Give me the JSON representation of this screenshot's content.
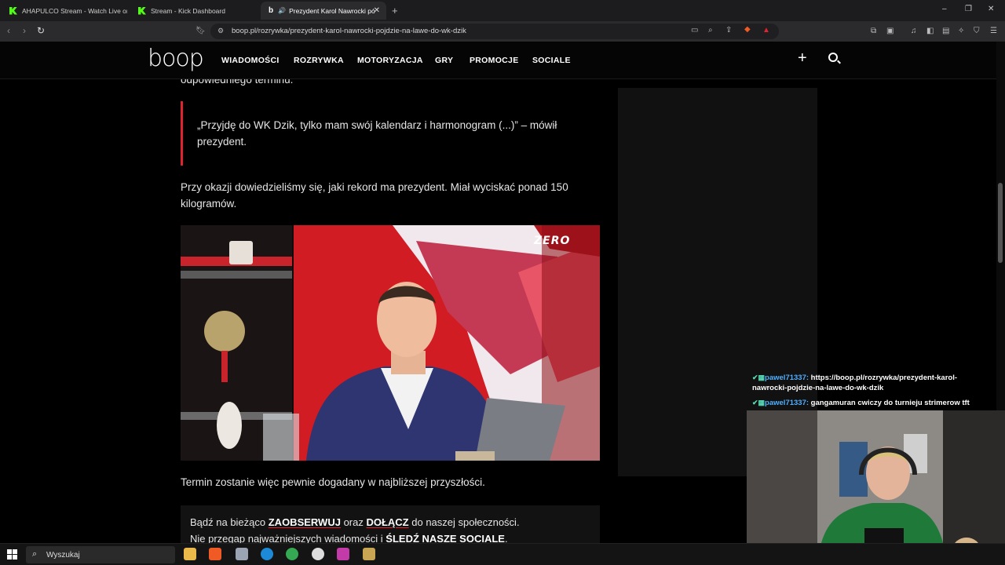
{
  "browser": {
    "tabs": [
      {
        "label": "AHAPULCO Stream - Watch Live on K",
        "active": false
      },
      {
        "label": "Stream - Kick Dashboard",
        "active": false
      },
      {
        "label": "Prezydent Karol Nawrocki pó",
        "active": true
      }
    ],
    "new_tab_label": "+",
    "url": "boop.pl/rozrywka/prezydent-karol-nawrocki-pojdzie-na-lawe-do-wk-dzik",
    "window_controls": [
      "–",
      "❐",
      "✕"
    ]
  },
  "site": {
    "logo": "boop",
    "nav": [
      "WIADOMOŚCI",
      "ROZRYWKA",
      "MOTORYZACJA",
      "GRY",
      "PROMOCJE",
      "SOCIALE"
    ],
    "accent": "#e0242e"
  },
  "article": {
    "fragment_top": "odpowiedniego terminu.",
    "quote": "„Przyjdę do WK Dzik, tylko mam swój kalendarz i harmonogram (...)” – mówił prezydent.",
    "paragraph1": "Przy okazji dowiedzieliśmy się, jaki rekord ma prezydent. Miał wyciskać ponad 150 kilogramów.",
    "image_watermark": "ZERO",
    "paragraph2": "Termin zostanie więc pewnie dogadany w najbliższej przyszłości.",
    "cta": {
      "line1_prefix": "Bądź na bieżąco ",
      "line1_link1": "ZAOBSERWUJ",
      "line1_mid": " oraz ",
      "line1_link2": "DOŁĄCZ",
      "line1_suffix": " do naszej społeczności.",
      "line2_prefix": "Nie przegap najważniejszych wiadomości i ",
      "line2_link": "ŚLEDŹ NASZE SOCIALE",
      "line2_suffix": "."
    }
  },
  "chat": [
    {
      "user": "pawel71337:",
      "message": "https://boop.pl/rozrywka/prezydent-karol-nawrocki-pojdzie-na-lawe-do-wk-dzik"
    },
    {
      "user": "pawel71337:",
      "message": "gangamuran cwiczy do turnieju strimerow tft"
    }
  ],
  "taskbar": {
    "search_label": "Wyszukaj"
  }
}
